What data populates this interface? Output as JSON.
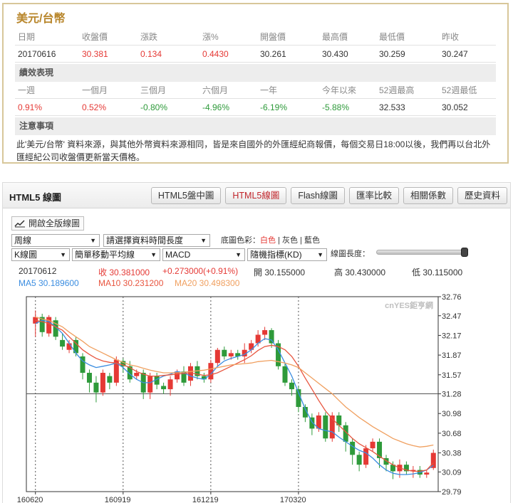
{
  "quote": {
    "title": "美元/台幣",
    "headers": [
      "日期",
      "收盤價",
      "漲跌",
      "漲%",
      "開盤價",
      "最高價",
      "最低價",
      "昨收"
    ],
    "values": [
      "20170616",
      "30.381",
      "0.134",
      "0.4430",
      "30.261",
      "30.430",
      "30.259",
      "30.247"
    ],
    "performance_title": "績效表現",
    "perf_headers": [
      "一週",
      "一個月",
      "三個月",
      "六個月",
      "一年",
      "今年以來",
      "52週最高",
      "52週最低"
    ],
    "perf_values": [
      "0.91%",
      "0.52%",
      "-0.80%",
      "-4.96%",
      "-6.19%",
      "-5.88%",
      "32.533",
      "30.052"
    ],
    "notes_title": "注意事項",
    "notes_text": "此'美元/台幣' 資料來源，與其他外幣資料來源相同，皆是來自國外的外匯經紀商報價，每個交易日18:00以後，我們再以台北外匯經紀公司收盤價更新當天價格。"
  },
  "chart_panel": {
    "title": "HTML5 線圖",
    "tabs": [
      {
        "label": "HTML5盤中圖",
        "active": false
      },
      {
        "label": "HTML5線圖",
        "active": true
      },
      {
        "label": "Flash線圖",
        "active": false
      },
      {
        "label": "匯率比較",
        "active": false
      },
      {
        "label": "相關係數",
        "active": false
      },
      {
        "label": "歷史資料",
        "active": false
      }
    ],
    "fullversion_label": "開啟全版線圖",
    "period_select": "周線",
    "timerange_select": "請選擇資料時間長度",
    "bgcolor_prefix": "底圖色彩：",
    "bgcolor_white": "白色",
    "bgcolor_gray": "灰色",
    "bgcolor_blue": "藍色",
    "bgcolor_sep": "|",
    "chart_type_select": "K線圖",
    "ma_select": "簡單移動平均線",
    "macd_select": "MACD",
    "kd_select": "隨機指標(KD)",
    "length_label": "線圖長度：",
    "info": {
      "date": "20170612",
      "close": "收 30.381000",
      "change": "+0.273000(+0.91%)",
      "open": "開 30.155000",
      "high": "高 30.430000",
      "low": "低 30.115000",
      "ma5": "MA5 30.189600",
      "ma10": "MA10 30.231200",
      "ma20": "MA20 30.498300"
    },
    "watermark": "cnYES鉅亨網"
  },
  "colors": {
    "up": "#e53935",
    "down": "#2e9a3a",
    "ma5": "#3b8de0",
    "ma10": "#e8553f",
    "ma20": "#f0a060",
    "gold": "#b8862b"
  },
  "chart_data": {
    "type": "candlestick",
    "y_ticks": [
      "32.76",
      "32.47",
      "32.17",
      "31.87",
      "31.57",
      "31.28",
      "30.98",
      "30.68",
      "30.38",
      "30.09",
      "29.79"
    ],
    "ylim": [
      29.79,
      32.76
    ],
    "x_ticks": [
      "160620",
      "160919",
      "161219",
      "170320"
    ],
    "series": [
      {
        "name": "MA5",
        "values": [
          32.35,
          32.4,
          32.38,
          32.3,
          32.2,
          32.05,
          31.9,
          31.78,
          31.72,
          31.68,
          31.7,
          31.72,
          31.75,
          31.68,
          31.58,
          31.5,
          31.45,
          31.45,
          31.5,
          31.55,
          31.58,
          31.62,
          31.6,
          31.55,
          31.52,
          31.5,
          31.58,
          31.7,
          31.78,
          31.82,
          31.85,
          31.88,
          31.95,
          32.05,
          32.12,
          32.1,
          31.95,
          31.75,
          31.55,
          31.3,
          31.05,
          30.85,
          30.75,
          30.72,
          30.7,
          30.62,
          30.55,
          30.48,
          30.42,
          30.38,
          30.3,
          30.2,
          30.12,
          30.07,
          30.05,
          30.05,
          30.06,
          30.08,
          30.12,
          30.19
        ]
      },
      {
        "name": "MA10",
        "values": [
          32.4,
          32.38,
          32.35,
          32.3,
          32.25,
          32.15,
          32.05,
          31.95,
          31.88,
          31.82,
          31.78,
          31.76,
          31.75,
          31.72,
          31.68,
          31.62,
          31.58,
          31.55,
          31.55,
          31.56,
          31.57,
          31.58,
          31.59,
          31.6,
          31.58,
          31.56,
          31.57,
          31.6,
          31.65,
          31.7,
          31.75,
          31.8,
          31.86,
          31.94,
          32.0,
          32.02,
          32.0,
          31.95,
          31.85,
          31.7,
          31.52,
          31.35,
          31.18,
          31.02,
          30.9,
          30.8,
          30.7,
          30.6,
          30.52,
          30.46,
          30.4,
          30.33,
          30.26,
          30.2,
          30.15,
          30.12,
          30.1,
          30.1,
          30.12,
          30.23
        ]
      },
      {
        "name": "MA20",
        "values": [
          32.45,
          32.42,
          32.4,
          32.35,
          32.3,
          32.22,
          32.15,
          32.08,
          32.0,
          31.95,
          31.9,
          31.85,
          31.8,
          31.76,
          31.72,
          31.7,
          31.67,
          31.64,
          31.62,
          31.6,
          31.6,
          31.6,
          31.61,
          31.62,
          31.63,
          31.64,
          31.66,
          31.68,
          31.7,
          31.72,
          31.73,
          31.74,
          31.75,
          31.77,
          31.78,
          31.79,
          31.77,
          31.75,
          31.72,
          31.68,
          31.6,
          31.52,
          31.44,
          31.36,
          31.28,
          31.18,
          31.08,
          31.0,
          30.92,
          30.85,
          30.78,
          30.72,
          30.66,
          30.6,
          30.56,
          30.52,
          30.49,
          30.47,
          30.48,
          30.5
        ]
      }
    ],
    "candles": [
      [
        32.35,
        32.45,
        32.55,
        32.15
      ],
      [
        32.45,
        32.22,
        32.5,
        32.15
      ],
      [
        32.2,
        32.45,
        32.48,
        32.15
      ],
      [
        32.4,
        32.15,
        32.45,
        32.1
      ],
      [
        32.1,
        32.0,
        32.2,
        31.95
      ],
      [
        31.95,
        32.05,
        32.1,
        31.9
      ],
      [
        32.1,
        31.9,
        32.15,
        31.85
      ],
      [
        31.85,
        31.6,
        31.9,
        31.5
      ],
      [
        31.6,
        31.45,
        31.65,
        31.3
      ],
      [
        31.45,
        31.3,
        31.55,
        31.15
      ],
      [
        31.3,
        31.6,
        31.65,
        31.25
      ],
      [
        31.55,
        31.45,
        31.6,
        31.35
      ],
      [
        31.45,
        31.8,
        31.85,
        31.4
      ],
      [
        31.78,
        31.7,
        31.82,
        31.6
      ],
      [
        31.7,
        31.5,
        31.78,
        31.45
      ],
      [
        31.55,
        31.6,
        31.65,
        31.5
      ],
      [
        31.6,
        31.3,
        31.65,
        31.2
      ],
      [
        31.3,
        31.55,
        31.6,
        31.2
      ],
      [
        31.55,
        31.42,
        31.6,
        31.35
      ],
      [
        31.4,
        31.35,
        31.45,
        31.28
      ],
      [
        31.35,
        31.5,
        31.55,
        31.25
      ],
      [
        31.5,
        31.62,
        31.65,
        31.45
      ],
      [
        31.62,
        31.45,
        31.7,
        31.4
      ],
      [
        31.48,
        31.7,
        31.75,
        31.4
      ],
      [
        31.7,
        31.55,
        31.78,
        31.5
      ],
      [
        31.55,
        31.5,
        31.6,
        31.45
      ],
      [
        31.5,
        31.75,
        31.8,
        31.45
      ],
      [
        31.75,
        31.95,
        31.98,
        31.7
      ],
      [
        31.95,
        31.85,
        32.0,
        31.8
      ],
      [
        31.85,
        31.9,
        31.95,
        31.8
      ],
      [
        31.9,
        31.85,
        31.95,
        31.8
      ],
      [
        31.85,
        31.95,
        32.05,
        31.75
      ],
      [
        31.95,
        32.05,
        32.1,
        31.9
      ],
      [
        32.05,
        32.18,
        32.25,
        32.0
      ],
      [
        32.18,
        32.25,
        32.3,
        32.1
      ],
      [
        32.25,
        32.05,
        32.28,
        31.98
      ],
      [
        32.05,
        31.7,
        32.1,
        31.65
      ],
      [
        31.7,
        31.45,
        31.75,
        31.4
      ],
      [
        31.45,
        31.35,
        31.5,
        31.25
      ],
      [
        31.35,
        31.08,
        31.4,
        31.0
      ],
      [
        31.08,
        30.92,
        31.12,
        30.85
      ],
      [
        30.92,
        30.75,
        30.98,
        30.65
      ],
      [
        30.75,
        30.95,
        31.0,
        30.7
      ],
      [
        30.95,
        30.6,
        31.0,
        30.55
      ],
      [
        30.6,
        30.95,
        31.0,
        30.55
      ],
      [
        30.95,
        30.8,
        31.0,
        30.7
      ],
      [
        30.8,
        30.55,
        30.85,
        30.4
      ],
      [
        30.55,
        30.35,
        30.6,
        30.2
      ],
      [
        30.35,
        30.2,
        30.4,
        30.1
      ],
      [
        30.2,
        30.45,
        30.5,
        30.15
      ],
      [
        30.45,
        30.55,
        30.6,
        30.4
      ],
      [
        30.55,
        30.3,
        30.6,
        30.15
      ],
      [
        30.3,
        30.2,
        30.35,
        30.1
      ],
      [
        30.2,
        30.1,
        30.25,
        29.98
      ],
      [
        30.1,
        30.2,
        30.28,
        30.0
      ],
      [
        30.2,
        30.1,
        30.25,
        30.05
      ],
      [
        30.1,
        30.12,
        30.18,
        30.0
      ],
      [
        30.12,
        30.05,
        30.18,
        30.0
      ],
      [
        30.05,
        30.08,
        30.12,
        30.0
      ],
      [
        30.15,
        30.38,
        30.43,
        30.12
      ]
    ]
  }
}
